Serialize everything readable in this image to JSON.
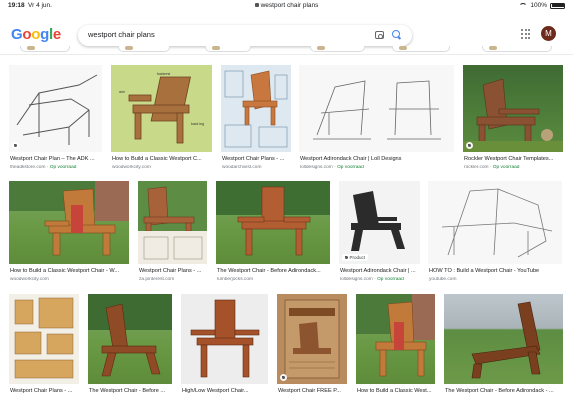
{
  "status_bar": {
    "time": "19:18",
    "date": "Vr 4 jun.",
    "url": "westport chair plans",
    "battery": "100%"
  },
  "header": {
    "logo": [
      "G",
      "o",
      "o",
      "g",
      "l",
      "e"
    ],
    "query": "westport chair plans",
    "avatar_letter": "M"
  },
  "colors": {
    "accent_blue": "#4285f4",
    "source_green": "#188038",
    "avatar": "#6d2b1b"
  },
  "results": [
    {
      "caption": "Westport Chair Plan – The ADK ...",
      "source": "theadkstore.com",
      "download": "· Op voorraad",
      "badge": ""
    },
    {
      "caption": "How to Build a Classic Westport C...",
      "source": "woodworkcity.com",
      "download": "",
      "badge": ""
    },
    {
      "caption": "Westport Chair Plans - ...",
      "source": "woodarchivist.com",
      "download": "",
      "badge": ""
    },
    {
      "caption": "Westport Adirondack Chair | Loll Designs",
      "source": "lolldesigns.com",
      "download": "· Op voorraad",
      "badge": ""
    },
    {
      "caption": "Rockler Westport Chair Templates...",
      "source": "rockler.com",
      "download": "· Op voorraad",
      "badge": ""
    },
    {
      "caption": "How to Build a Classic Westport Chair - W...",
      "source": "woodworkcity.com",
      "download": "",
      "badge": ""
    },
    {
      "caption": "Westport Chair Plans - ...",
      "source": "za.pinterest.com",
      "download": "",
      "badge": ""
    },
    {
      "caption": "The Westport Chair - Before Adirondack...",
      "source": "lumberjocks.com",
      "download": "",
      "badge": ""
    },
    {
      "caption": "Westport Adirondack Chair | ...",
      "source": "lolldesigns.com",
      "download": "· Op voorraad",
      "badge": "Product"
    },
    {
      "caption": "HOW TO : Build a Westport Chair - YouTube",
      "source": "youtube.com",
      "download": "",
      "badge": ""
    },
    {
      "caption": "Westport Chair Plans - ...",
      "source": "",
      "download": "",
      "badge": ""
    },
    {
      "caption": "The Westport Chair - Before ...",
      "source": "",
      "download": "",
      "badge": ""
    },
    {
      "caption": "High/Low Westport Chair...",
      "source": "",
      "download": "",
      "badge": ""
    },
    {
      "caption": "Westport Chair FREE P...",
      "source": "",
      "download": "",
      "badge": ""
    },
    {
      "caption": "How to Build a Classic West...",
      "source": "",
      "download": "",
      "badge": ""
    },
    {
      "caption": "The Westport Chair - Before Adirondack - ...",
      "source": "",
      "download": "",
      "badge": ""
    }
  ],
  "icons": [
    "lock-icon",
    "wifi-icon",
    "battery-icon",
    "camera-icon",
    "search-icon",
    "apps-icon",
    "tag-icon"
  ]
}
